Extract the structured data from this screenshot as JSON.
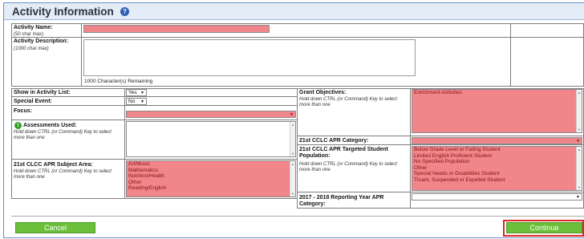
{
  "header": {
    "title": "Activity Information",
    "help_icon": "help-icon"
  },
  "activity_name": {
    "label": "Activity Name:",
    "hint": "(50 char max)",
    "value": ""
  },
  "activity_description": {
    "label": "Activity Description:",
    "hint": "(1000 char max)",
    "value": "",
    "remaining": "1000 Character(s) Remaining"
  },
  "show_in_list": {
    "label": "Show in Activity List:",
    "value": "Yes"
  },
  "special_event": {
    "label": "Special Event:",
    "value": "No"
  },
  "focus": {
    "label": "Focus:",
    "value": ""
  },
  "assessments": {
    "label": "Assessments Used:",
    "hint": "Hold down CTRL (or Command) Key to select more than one",
    "icon": "info-icon"
  },
  "subject_area": {
    "label": "21st CLCC APR Subject Area:",
    "hint": "Hold down CTRL (or Command) Key to select more than one",
    "options": [
      "Art/Music",
      "Mathematics",
      "Nutrition/Health",
      "Other",
      "Reading/English"
    ]
  },
  "grant_objectives": {
    "label": "Grant Objectives:",
    "hint": "Hold down CTRL (or Command) Key to select more than one",
    "options": [
      "Enrichment Activities"
    ]
  },
  "apr_category": {
    "label": "21st CCLC APR Category:",
    "value": ""
  },
  "targeted_population": {
    "label": "21st CCLC APR Targeted Student Population:",
    "hint": "Hold down CTRL (or Command) Key to select more than one",
    "options": [
      "Below Grade Level or Failing Student",
      "Limited English Proficient Student",
      "No Specified Population",
      "Other",
      "Special Needs or Disabilities Student",
      "Truant, Suspended or Expelled Student"
    ]
  },
  "reporting_category": {
    "label": "2017 - 2018 Reporting Year APR Category:",
    "value": ""
  },
  "buttons": {
    "cancel": "Cancel",
    "continue": "Continue"
  },
  "colors": {
    "required_field": "#f0868a",
    "button_green": "#6bbf3b",
    "highlight_outline": "#e0252b",
    "header_bg": "#e3ecf7"
  }
}
